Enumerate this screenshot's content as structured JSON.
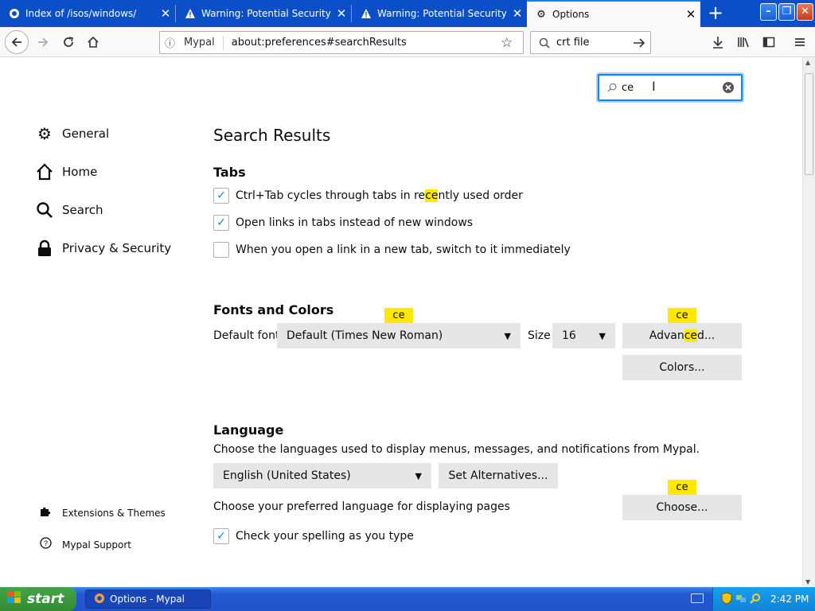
{
  "tabs": [
    {
      "label": "Index of /isos/windows/",
      "icon": "page-icon"
    },
    {
      "label": "Warning: Potential Security Risk Ahead",
      "icon": "warning-icon"
    },
    {
      "label": "Warning: Potential Security Risk Ahead",
      "icon": "warning-icon"
    },
    {
      "label": "Options",
      "icon": "gear-icon",
      "active": true
    }
  ],
  "urlbar": {
    "site": "Mypal",
    "url": "about:preferences#searchResults"
  },
  "searchbar": {
    "value": "crt file"
  },
  "prefs_search": {
    "value": "ce"
  },
  "sidebar": {
    "items": [
      {
        "label": "General",
        "icon": "gear-icon"
      },
      {
        "label": "Home",
        "icon": "home-icon"
      },
      {
        "label": "Search",
        "icon": "search-icon"
      },
      {
        "label": "Privacy & Security",
        "icon": "lock-icon"
      }
    ],
    "footer": [
      {
        "label": "Extensions & Themes",
        "icon": "puzzle-icon"
      },
      {
        "label": "Mypal Support",
        "icon": "help-icon"
      }
    ]
  },
  "main": {
    "title": "Search Results",
    "tabs_section": {
      "heading": "Tabs",
      "options": [
        {
          "pre": "Ctrl+Tab cycles through tabs in re",
          "hl": "ce",
          "post": "ntly used order",
          "checked": true
        },
        {
          "pre": "Open links in tabs instead of new windows",
          "hl": "",
          "post": "",
          "checked": true
        },
        {
          "pre": "When you open a link in a new tab, switch to it immediately",
          "hl": "",
          "post": "",
          "checked": false
        }
      ]
    },
    "fonts": {
      "heading": "Fonts and Colors",
      "default_font_label": "Default font",
      "default_font_value": "Default (Times New Roman)",
      "size_label": "Size",
      "size_value": "16",
      "advanced_pre": "Advan",
      "advanced_hl": "ce",
      "advanced_post": "d...",
      "colors_label": "Colors...",
      "bubble": "ce"
    },
    "language": {
      "heading": "Language",
      "description": "Choose the languages used to display menus, messages, and notifications from Mypal.",
      "locale_value": "English (United States)",
      "set_alternatives": "Set Alternatives...",
      "page_lang_text": "Choose your preferred language for displaying pages",
      "choose_label": "Choose...",
      "spelling": "Check your spelling as you type",
      "bubble": "ce"
    }
  },
  "taskbar": {
    "start": "start",
    "task": "Options - Mypal",
    "clock": "2:42 PM"
  },
  "colors": {
    "accent": "#0a84ff",
    "highlight": "#ffe900",
    "xp_blue": "#2254cc"
  }
}
